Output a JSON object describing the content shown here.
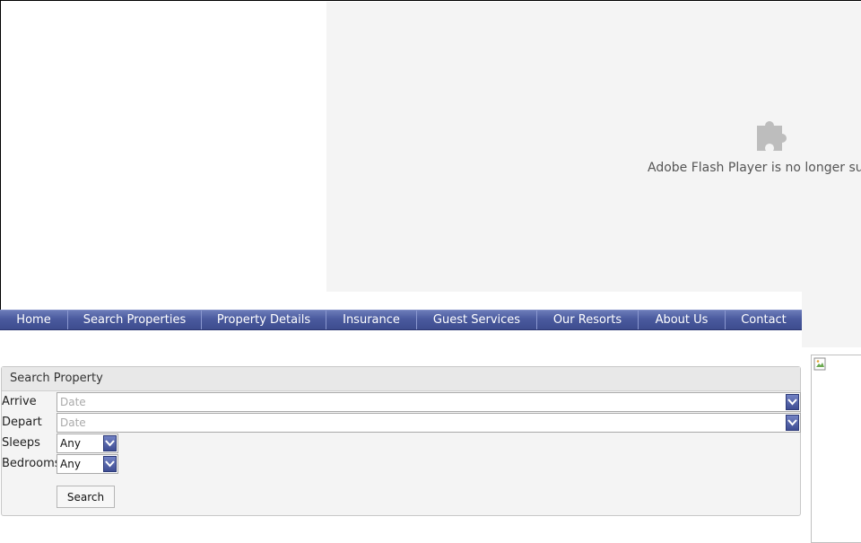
{
  "flash": {
    "icon": "puzzle-plugin-icon",
    "message": "Adobe Flash Player is no longer sup"
  },
  "nav": {
    "items": [
      {
        "label": "Home"
      },
      {
        "label": "Search Properties"
      },
      {
        "label": "Property Details"
      },
      {
        "label": "Insurance"
      },
      {
        "label": "Guest Services"
      },
      {
        "label": "Our Resorts"
      },
      {
        "label": "About Us"
      },
      {
        "label": "Contact"
      }
    ]
  },
  "search": {
    "title": "Search Property",
    "arrive_label": "Arrive",
    "arrive_placeholder": "Date",
    "depart_label": "Depart",
    "depart_placeholder": "Date",
    "sleeps_label": "Sleeps",
    "sleeps_value": "Any",
    "bedrooms_label": "Bedrooms",
    "bedrooms_value": "Any",
    "button_label": "Search"
  },
  "colors": {
    "nav_bg": "#4a5a9e",
    "panel_bg": "#f4f4f4"
  }
}
